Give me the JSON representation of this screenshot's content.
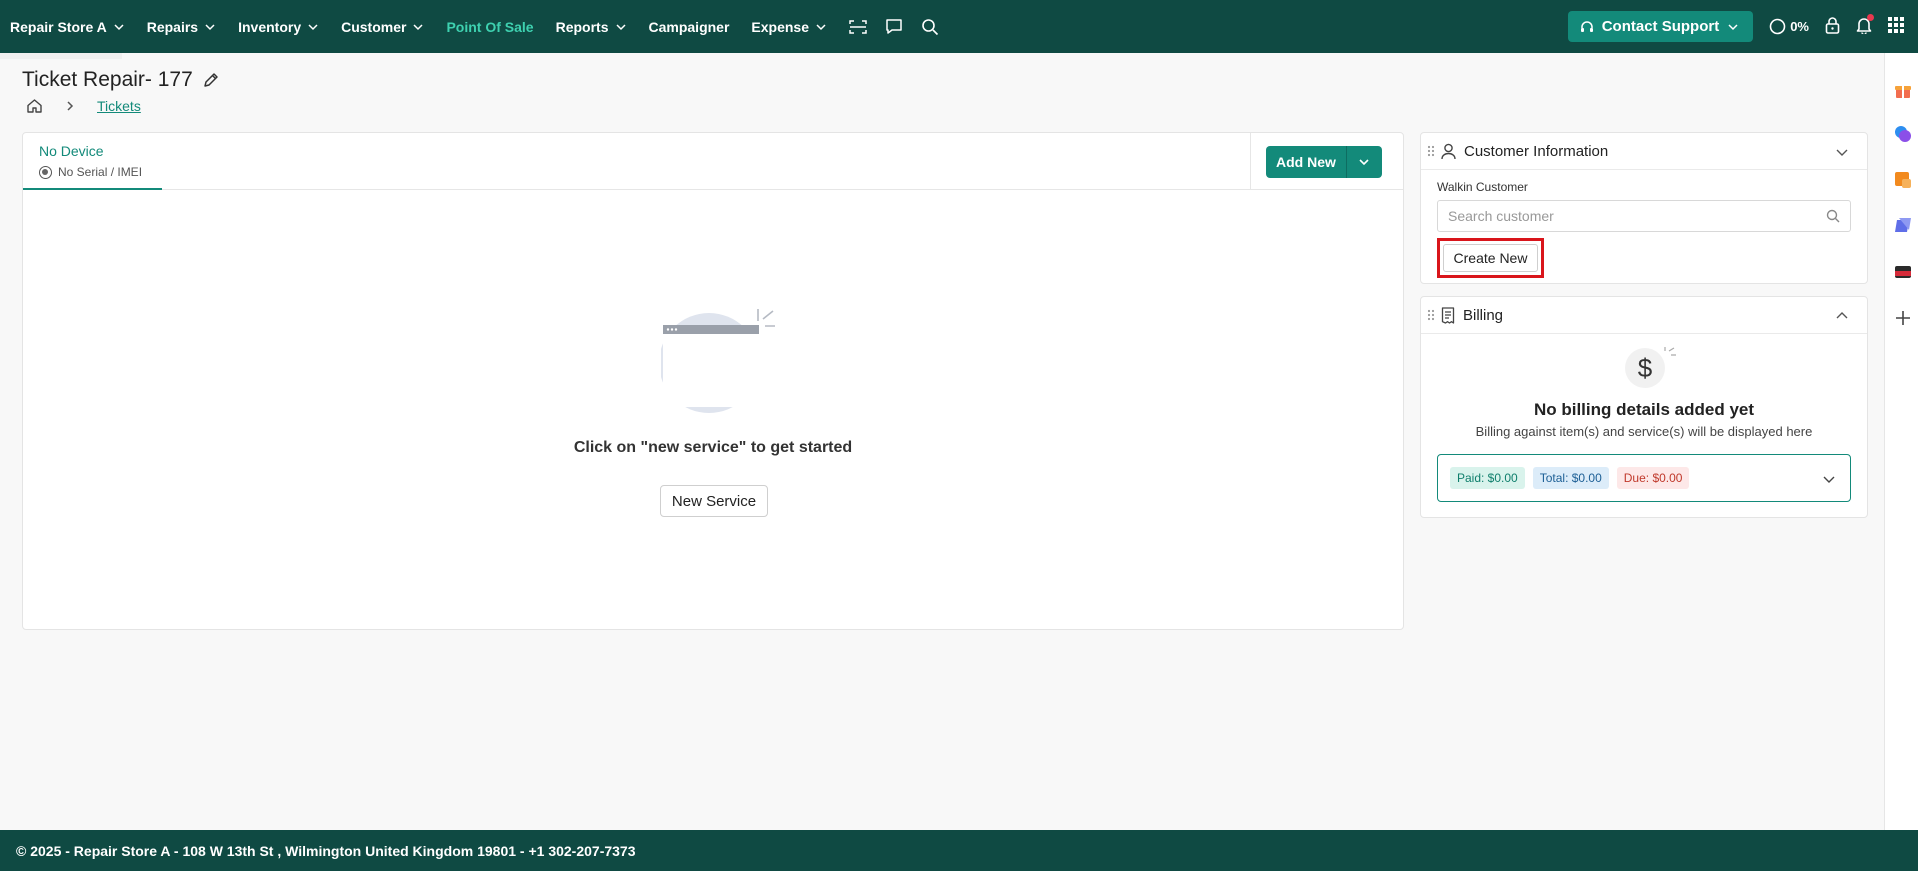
{
  "nav": {
    "store": "Repair Store A",
    "items": [
      {
        "label": "Repairs",
        "dropdown": true
      },
      {
        "label": "Inventory",
        "dropdown": true
      },
      {
        "label": "Customer",
        "dropdown": true
      },
      {
        "label": "Point Of Sale",
        "dropdown": false,
        "active": true
      },
      {
        "label": "Reports",
        "dropdown": true
      },
      {
        "label": "Campaigner",
        "dropdown": false
      },
      {
        "label": "Expense",
        "dropdown": true
      }
    ],
    "support_label": "Contact Support",
    "progress": "0%",
    "icons": [
      "scan-icon",
      "chat-icon",
      "search-icon",
      "headset-icon",
      "progress-ring-icon",
      "lock-icon",
      "bell-icon",
      "apps-grid-icon"
    ]
  },
  "page": {
    "title": "Ticket Repair- 177",
    "breadcrumb_link": "Tickets"
  },
  "device": {
    "name": "No Device",
    "serial": "No Serial / IMEI"
  },
  "actions": {
    "add_new": "Add New"
  },
  "empty_state": {
    "message": "Click on \"new service\" to get started",
    "button": "New Service"
  },
  "customer": {
    "title": "Customer Information",
    "walkin_label": "Walkin Customer",
    "search_placeholder": "Search customer",
    "create_new": "Create New"
  },
  "billing": {
    "title": "Billing",
    "empty_title": "No billing details added yet",
    "empty_sub": "Billing against item(s) and service(s) will be displayed here",
    "paid": "Paid: $0.00",
    "total": "Total: $0.00",
    "due": "Due: $0.00"
  },
  "footer": {
    "text": "© 2025 - Repair Store A - 108 W 13th St , Wilmington United Kingdom 19801 - +1 302-207-7373"
  },
  "colors": {
    "nav_bg": "#0f4a43",
    "accent": "#138a7a",
    "active_nav": "#3ed1b0",
    "highlight": "#d9151b"
  }
}
